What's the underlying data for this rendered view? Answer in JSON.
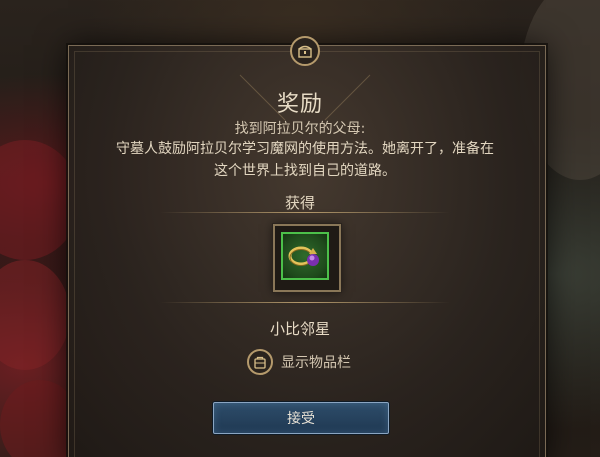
{
  "dialog": {
    "title": "奖励",
    "subtitle": "找到阿拉贝尔的父母:",
    "description_line1": "守墓人鼓励阿拉贝尔学习魔网的使用方法。她离开了，准备在",
    "description_line2": "这个世界上找到自己的道路。",
    "obtained_label": "获得",
    "item": {
      "name": "小比邻星",
      "icon": "ring-icon",
      "rarity_color": "#4cc04a"
    },
    "inventory_label": "显示物品栏",
    "accept_label": "接受"
  },
  "colors": {
    "accent_gold": "#b59a6c",
    "button_blue": "#2e4d6a",
    "text_primary": "#e8dcc6"
  }
}
